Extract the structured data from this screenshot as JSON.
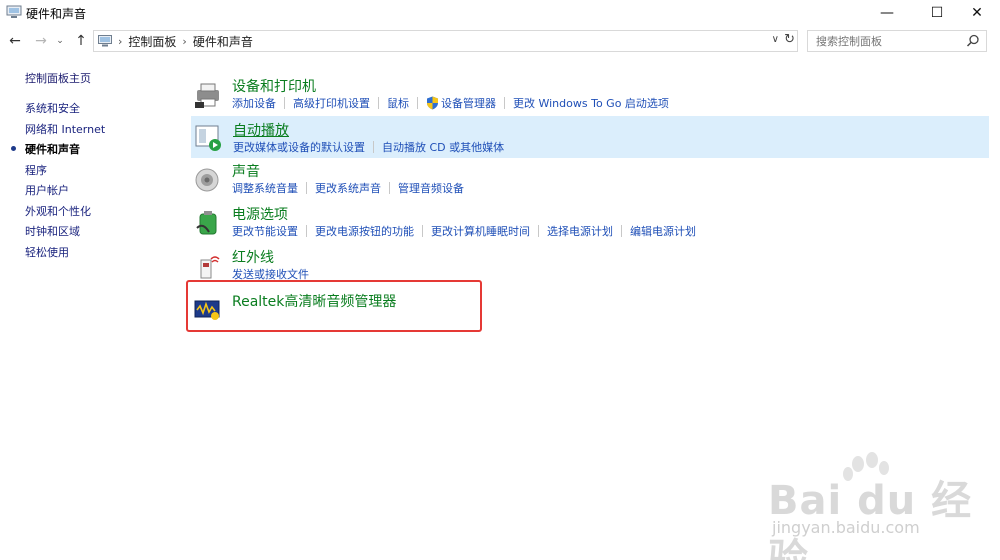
{
  "window": {
    "title": "硬件和声音",
    "minimize": "—",
    "maximize": "☐",
    "close": "✕"
  },
  "nav": {
    "back": "←",
    "forward": "→",
    "recent": "⌄",
    "up": "↑",
    "breadcrumbs": [
      "控制面板",
      "硬件和声音"
    ],
    "dropdown": "∨",
    "refresh": "↻",
    "search_placeholder": "搜索控制面板"
  },
  "sidebar": {
    "home": "控制面板主页",
    "items": [
      {
        "label": "系统和安全",
        "active": false
      },
      {
        "label": "网络和 Internet",
        "active": false
      },
      {
        "label": "硬件和声音",
        "active": true
      },
      {
        "label": "程序",
        "active": false
      },
      {
        "label": "用户帐户",
        "active": false
      },
      {
        "label": "外观和个性化",
        "active": false
      },
      {
        "label": "时钟和区域",
        "active": false
      },
      {
        "label": "轻松使用",
        "active": false
      }
    ]
  },
  "categories": [
    {
      "heading": "设备和打印机",
      "icon": "printer-icon",
      "links": [
        "添加设备",
        "高级打印机设置",
        "鼠标",
        "设备管理器",
        "更改 Windows To Go 启动选项"
      ]
    },
    {
      "heading": "自动播放",
      "icon": "autoplay-icon",
      "links": [
        "更改媒体或设备的默认设置",
        "自动播放 CD 或其他媒体"
      ]
    },
    {
      "heading": "声音",
      "icon": "speaker-icon",
      "links": [
        "调整系统音量",
        "更改系统声音",
        "管理音频设备"
      ]
    },
    {
      "heading": "电源选项",
      "icon": "power-icon",
      "links": [
        "更改节能设置",
        "更改电源按钮的功能",
        "更改计算机睡眠时间",
        "选择电源计划",
        "编辑电源计划"
      ]
    },
    {
      "heading": "红外线",
      "icon": "infrared-icon",
      "links": [
        "发送或接收文件"
      ]
    },
    {
      "heading": "Realtek高清晰音频管理器",
      "icon": "realtek-icon",
      "links": []
    }
  ],
  "watermark": {
    "brand": "Bai du 经验",
    "url": "jingyan.baidu.com"
  },
  "colors": {
    "heading_green": "#0a7d1f",
    "link_blue": "#1f4fb7",
    "hover_bg": "#dbeefc",
    "highlight_red": "#e53935"
  }
}
